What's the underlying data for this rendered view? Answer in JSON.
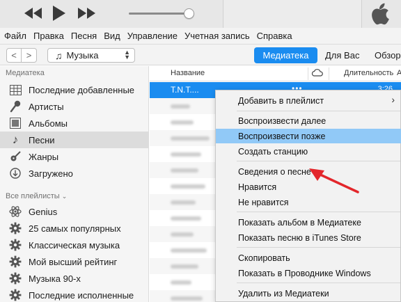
{
  "menubar": [
    "Файл",
    "Правка",
    "Песня",
    "Вид",
    "Управление",
    "Учетная запись",
    "Справка"
  ],
  "toolbar": {
    "back": "<",
    "forward": ">",
    "media_type": "Музыка",
    "tabs": [
      "Медиатека",
      "Для Вас",
      "Обзор"
    ]
  },
  "player": {
    "volume": 0.93
  },
  "sidebar": {
    "library_header": "Медиатека",
    "library_items": [
      {
        "label": "Последние добавленные",
        "icon": "grid-icon"
      },
      {
        "label": "Артисты",
        "icon": "microphone-icon"
      },
      {
        "label": "Альбомы",
        "icon": "album-icon"
      },
      {
        "label": "Песни",
        "icon": "music-note-icon",
        "selected": true
      },
      {
        "label": "Жанры",
        "icon": "guitar-icon"
      },
      {
        "label": "Загружено",
        "icon": "download-icon"
      }
    ],
    "playlists_header": "Все плейлисты",
    "playlist_items": [
      {
        "label": "Genius",
        "icon": "genius-icon"
      },
      {
        "label": "25 самых популярных",
        "icon": "gear-icon"
      },
      {
        "label": "Классическая музыка",
        "icon": "gear-icon"
      },
      {
        "label": "Мой высший рейтинг",
        "icon": "gear-icon"
      },
      {
        "label": "Музыка 90-х",
        "icon": "gear-icon"
      },
      {
        "label": "Последние исполненные",
        "icon": "gear-icon"
      }
    ]
  },
  "songs": {
    "col_name": "Название",
    "col_duration": "Длительность",
    "col_extra": "А",
    "selected_title": "T.N.T....",
    "selected_time": "3:26"
  },
  "context_menu": [
    {
      "label": "Добавить в плейлист",
      "submenu": "›"
    },
    {
      "label": "Воспроизвести далее"
    },
    {
      "label": "Воспроизвести позже",
      "highlighted": true
    },
    {
      "label": "Создать станцию"
    },
    {
      "label": "Сведения о песне"
    },
    {
      "label": "Нравится"
    },
    {
      "label": "Не нравится"
    },
    {
      "label": "Показать альбом в Медиатеке"
    },
    {
      "label": "Показать песню в iTunes Store"
    },
    {
      "label": "Скопировать"
    },
    {
      "label": "Показать в Проводнике Windows"
    },
    {
      "label": "Удалить из Медиатеки"
    }
  ],
  "colors": {
    "accent": "#1a8cf0",
    "menu_highlight": "#91c9f7",
    "annotation_arrow": "#e3262b"
  }
}
